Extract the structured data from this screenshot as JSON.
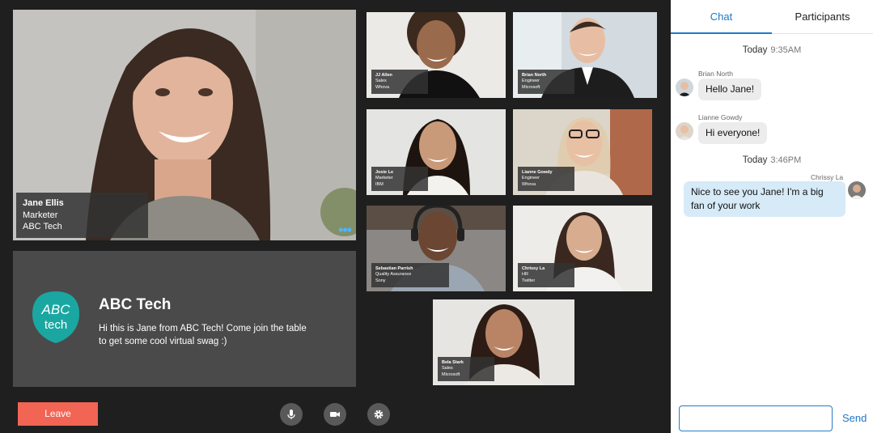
{
  "main_speaker": {
    "name": "Jane Ellis",
    "role": "Marketer",
    "company": "ABC Tech",
    "more": "•••"
  },
  "brand": {
    "title": "ABC Tech",
    "message": "Hi this is Jane from ABC Tech! Come join the table to get some cool virtual swag :)",
    "logo_top": "ABC",
    "logo_bottom": "tech",
    "accent": "#1aa7a1"
  },
  "participants": [
    {
      "name": "JJ Allen",
      "role": "Sales",
      "company": "Whova"
    },
    {
      "name": "Brian North",
      "role": "Engineer",
      "company": "Microsoft"
    },
    {
      "name": "Josie Le",
      "role": "Marketer",
      "company": "IBM"
    },
    {
      "name": "Lianne Gowdy",
      "role": "Engineer",
      "company": "Whova"
    },
    {
      "name": "Sebastian Parrish",
      "role": "Quality Assurance",
      "company": "Sony"
    },
    {
      "name": "Chrissy La",
      "role": "HR",
      "company": "Twitter"
    },
    {
      "name": "Bela Stark",
      "role": "Sales",
      "company": "Microsoft"
    }
  ],
  "controls": {
    "leave": "Leave",
    "mic_icon": "microphone-icon",
    "camera_icon": "video-camera-icon",
    "settings_icon": "gear-icon",
    "leave_color": "#f26454"
  },
  "panel": {
    "tabs": [
      "Chat",
      "Participants"
    ],
    "active_tab": "Chat",
    "accent": "#1e78c8",
    "groups": [
      {
        "day": "Today",
        "time": "9:35AM"
      },
      {
        "day": "Today",
        "time": "3:46PM"
      }
    ],
    "messages": [
      {
        "sender": "Brian North",
        "text": "Hello Jane!"
      },
      {
        "sender": "Lianne Gowdy",
        "text": "Hi everyone!"
      },
      {
        "sender": "Chrissy La",
        "text": "Nice to see you Jane! I'm a big fan of your work"
      }
    ],
    "input_value": "",
    "send": "Send"
  }
}
